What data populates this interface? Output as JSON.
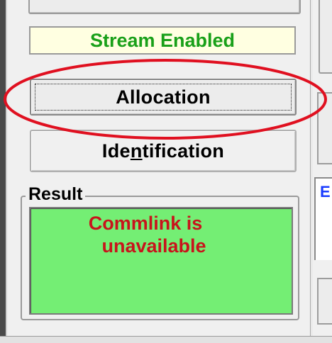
{
  "status": {
    "text": "Stream Enabled",
    "color": "#19a019"
  },
  "buttons": {
    "allocation": {
      "pre": "Al",
      "mnemonic": "l",
      "post": "ocation"
    },
    "identification": {
      "pre": "Ide",
      "mnemonic": "n",
      "post": "tification"
    }
  },
  "result": {
    "group_title": "Result",
    "line1": "Commlink is",
    "line2": "unavailable",
    "background": "#74ee74",
    "text_color": "#c8141c"
  },
  "right_panel": {
    "partial_text": "E"
  },
  "highlight": {
    "shape": "ellipse",
    "color": "#e01020",
    "target": "allocation-button"
  }
}
